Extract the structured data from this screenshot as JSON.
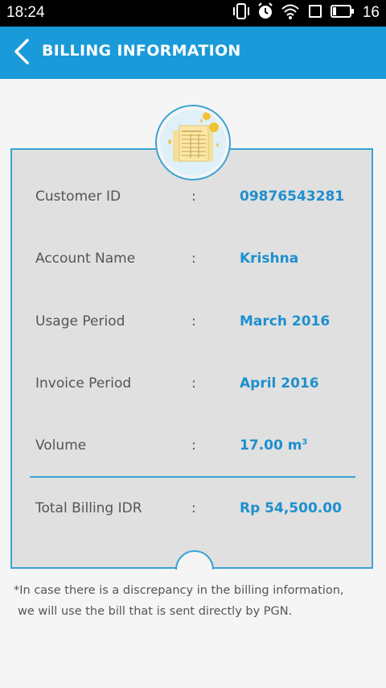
{
  "status_bar": {
    "time": "18:24",
    "battery_level": "16",
    "icons": [
      "vibrate-icon",
      "alarm-icon",
      "wifi-icon",
      "notification-icon",
      "battery-icon"
    ]
  },
  "header": {
    "title": "BILLING INFORMATION",
    "background_color": "#1a9ad8"
  },
  "billing": {
    "rows": [
      {
        "label": "Customer ID",
        "separator": ":",
        "value": "09876543281"
      },
      {
        "label": "Account Name",
        "separator": ":",
        "value": "Krishna"
      },
      {
        "label": "Usage Period",
        "separator": ":",
        "value": "March 2016"
      },
      {
        "label": "Invoice Period",
        "separator": ":",
        "value": "April 2016"
      },
      {
        "label": "Volume",
        "separator": ":",
        "value": "17.00 m",
        "unit_superscript": "3"
      }
    ],
    "total": {
      "label": "Total Billing IDR",
      "separator": ":",
      "value": "Rp 54,500.00"
    },
    "accent_color": "#1e8fcf"
  },
  "note": {
    "line1": "*In case there is a discrepancy in the billing information,",
    "line2": "we will use the bill that is sent directly by PGN."
  }
}
